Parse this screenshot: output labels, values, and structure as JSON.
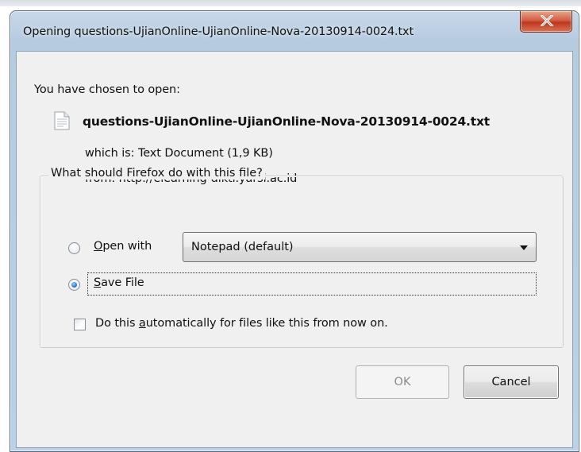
{
  "dialog": {
    "title": "Opening questions-UjianOnline-UjianOnline-Nova-20130914-0024.txt",
    "intro": "You have chosen to open:",
    "filename": "questions-UjianOnline-UjianOnline-Nova-20130914-0024.txt",
    "which_label": "which is:",
    "which_value": "Text Document (1,9 KB)",
    "from_label": "from:",
    "from_value": "http://elearning-dikti.yarsi.ac.id",
    "close_icon": "close-x-icon",
    "file_icon": "text-document-icon"
  },
  "action_group": {
    "legend": "What should Firefox do with this file?",
    "open_with": {
      "mnemonic": "O",
      "rest": "pen with",
      "selected": false,
      "app_selected": "Notepad (default)"
    },
    "save_file": {
      "mnemonic": "S",
      "rest": "ave File",
      "selected": true
    },
    "auto_checkbox": {
      "before": "Do this ",
      "mnemonic": "a",
      "after": "utomatically for files like this from now on.",
      "checked": false
    }
  },
  "buttons": {
    "ok": "OK",
    "cancel": "Cancel"
  },
  "colors": {
    "titlebar": "#bcd0e6",
    "close_button": "#c7432a",
    "client_bg": "#f0f0f0",
    "radio_dot": "#2c79d0"
  }
}
